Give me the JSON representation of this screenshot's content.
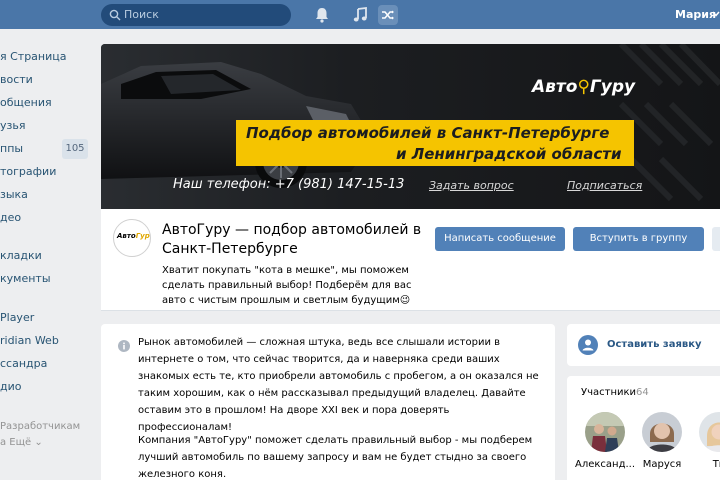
{
  "header": {
    "search_placeholder": "Поиск",
    "user_name": "Мария",
    "colors": {
      "bar": "#4a76a8",
      "search": "#224b7a"
    },
    "icons": [
      "bell-icon",
      "music-icon",
      "shuffle-icon"
    ]
  },
  "sidebar": {
    "items": [
      {
        "label": "я Страница"
      },
      {
        "label": "вости"
      },
      {
        "label": "общения"
      },
      {
        "label": "узья"
      },
      {
        "label": "ппы"
      },
      {
        "label": "тографии"
      },
      {
        "label": "зыка"
      },
      {
        "label": "део"
      },
      {
        "label": "кладки"
      },
      {
        "label": "кументы"
      },
      {
        "label": "Player"
      },
      {
        "label": "ridian Web"
      },
      {
        "label": "ссандра"
      },
      {
        "label": "дио"
      }
    ],
    "groups_count": "105",
    "footer_dev": "Разработчикам",
    "footer_more": "а  Ещё ⌄"
  },
  "cover": {
    "brand_prefix": "Авто",
    "brand_suffix": "Гуру",
    "tagline_line1": "Подбор автомобилей в Санкт-Петербурге",
    "tagline_line2": "и Ленинградской области",
    "phone": "Наш телефон: +7 (981) 147-15-13",
    "ask_link": "Задать вопрос",
    "subscribe_link": "Подписаться",
    "colors": {
      "accent": "#f5c400",
      "background": "#1b1d20"
    }
  },
  "group": {
    "avatar_text_a": "Авто",
    "avatar_text_b": "Гуру",
    "title": "АвтоГуру — подбор автомобилей в Санкт-Петербурге",
    "status": "Хватит покупать \"кота в мешке\", мы поможем сделать правильный выбор! Подберём для вас авто с чистым прошлым и светлым будущим😉",
    "message_button": "Написать сообщение",
    "join_button": "Вступить в группу"
  },
  "description": {
    "paragraph1": "Рынок автомобилей — сложная штука, ведь все слышали истории в интернете о том, что сейчас творится, да и наверняка среди ваших знакомых есть те, кто приобрели автомобиль с пробегом, а он оказался не таким хорошим, как о нём рассказывал предыдущий владелец. Давайте оставим это в прошлом! На дворе XXI век и пора доверять профессионалам!",
    "paragraph2": "Компания \"АвтоГуру\" поможет сделать правильный выбор - мы подберем лучший автомобиль по вашему запросу и вам не будет стыдно за своего железного коня."
  },
  "right": {
    "request_label": "Оставить заявку",
    "members_title": "Участники",
    "members_count": "64",
    "members": [
      {
        "name": "Александ..."
      },
      {
        "name": "Маруся"
      },
      {
        "name": "Ти"
      }
    ]
  }
}
